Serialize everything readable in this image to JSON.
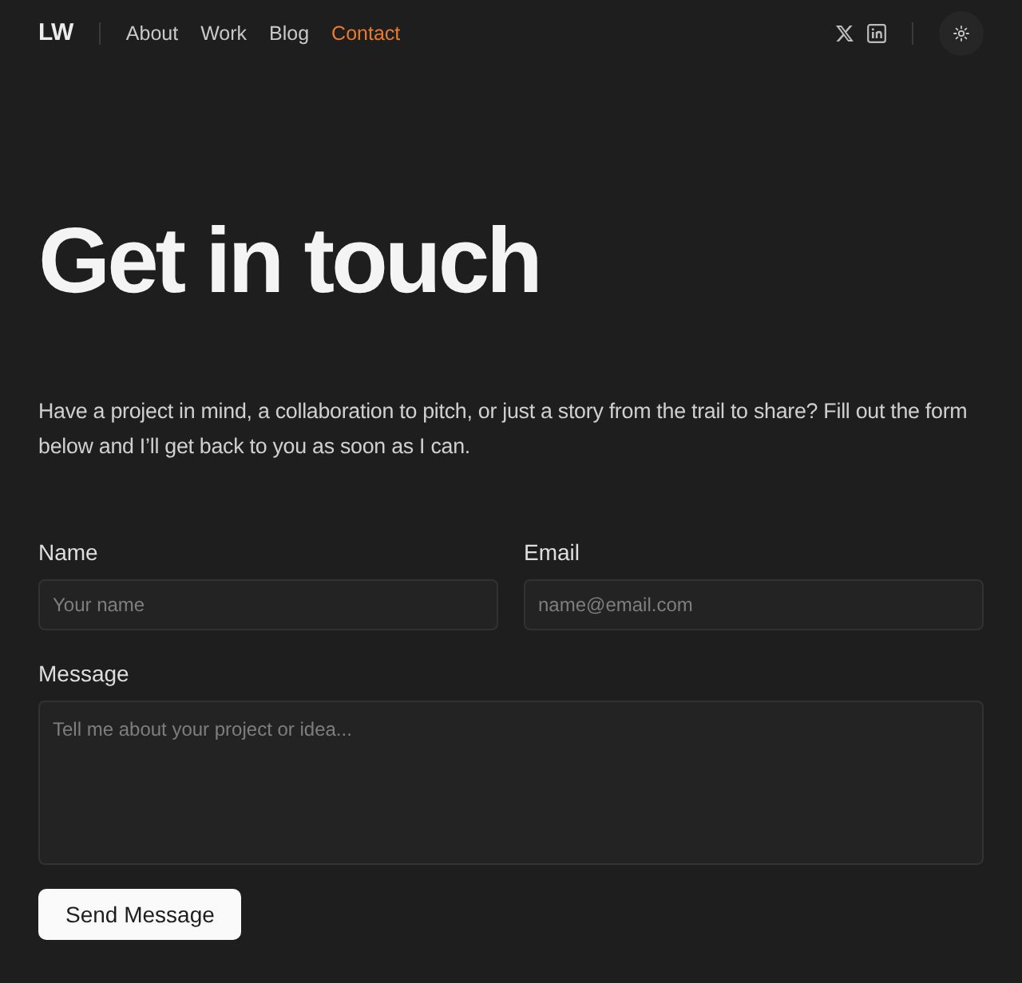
{
  "brand": "LW",
  "nav": [
    {
      "label": "About",
      "selected": false
    },
    {
      "label": "Work",
      "selected": false
    },
    {
      "label": "Blog",
      "selected": false
    },
    {
      "label": "Contact",
      "selected": true
    }
  ],
  "hero": {
    "title": "Get in touch",
    "intro": "Have a project in mind, a collaboration to pitch, or just a story from the trail to share? Fill out the form below and I’ll get back to you as soon as I can."
  },
  "form": {
    "fields": [
      {
        "kind": "input",
        "label": "Name",
        "placeholder": "Your name"
      },
      {
        "kind": "input",
        "label": "Email",
        "placeholder": "name@email.com"
      },
      {
        "kind": "textarea",
        "label": "Message",
        "placeholder": "Tell me about your project or idea..."
      }
    ],
    "submit": "Send Message"
  }
}
